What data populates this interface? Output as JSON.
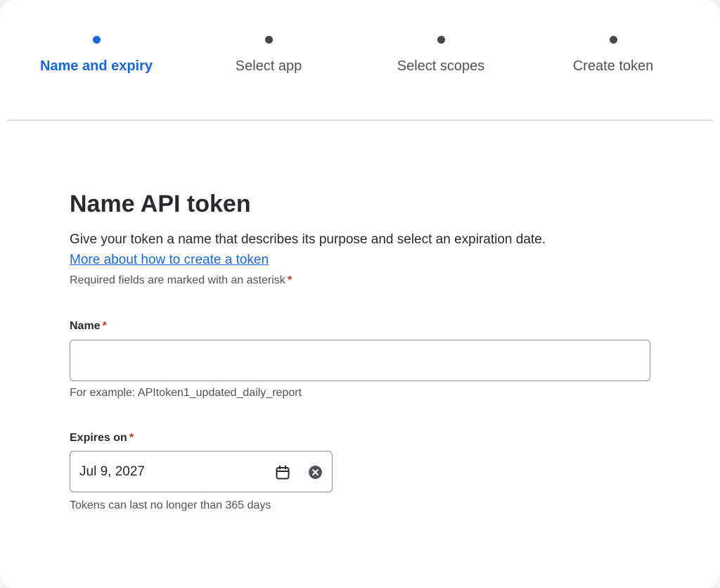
{
  "stepper": {
    "steps": [
      {
        "label": "Name and expiry",
        "active": true
      },
      {
        "label": "Select app",
        "active": false
      },
      {
        "label": "Select scopes",
        "active": false
      },
      {
        "label": "Create token",
        "active": false
      }
    ]
  },
  "form": {
    "title": "Name API token",
    "description": "Give your token a name that describes its purpose and select an expiration date.",
    "help_link": "More about how to create a token",
    "required_note": "Required fields are marked with an asterisk",
    "asterisk": "*",
    "name_field": {
      "label": "Name",
      "value": "",
      "placeholder": "",
      "help": "For example: APItoken1_updated_daily_report"
    },
    "expiry_field": {
      "label": "Expires on",
      "value": "Jul 9, 2027",
      "help": "Tokens can last no longer than 365 days"
    }
  },
  "icons": {
    "calendar": "calendar-icon",
    "clear": "clear-icon"
  },
  "colors": {
    "accent": "#1868db",
    "required": "#c9372c",
    "text": "#292a2e",
    "subtle_text": "#505258",
    "border": "#8c8f97"
  }
}
